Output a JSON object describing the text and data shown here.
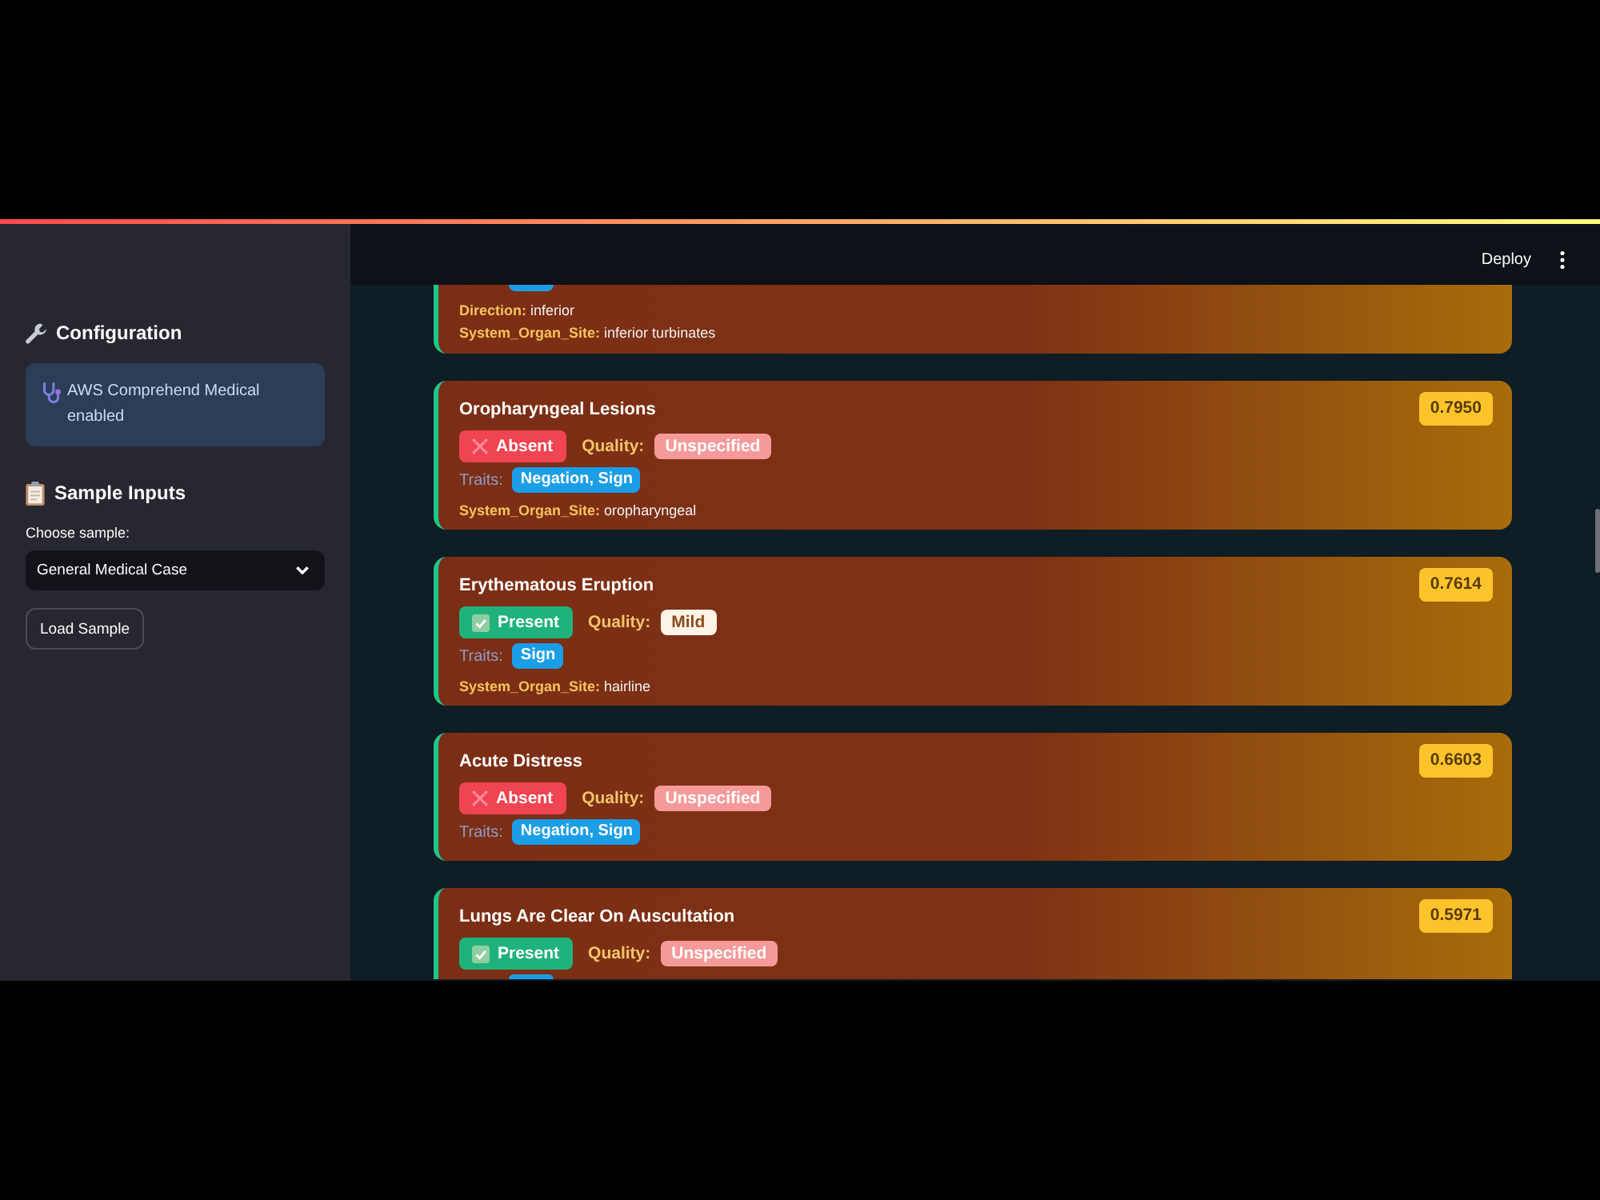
{
  "header": {
    "deploy": "Deploy"
  },
  "sidebar": {
    "configuration": {
      "title": "Configuration",
      "message": "AWS Comprehend Medical enabled"
    },
    "sample_inputs": {
      "title": "Sample Inputs",
      "select": {
        "label": "Choose sample:",
        "value": "General Medical Case"
      },
      "button": "Load Sample"
    }
  },
  "entities": [
    {
      "kind": "top_cut",
      "details": [
        "**Direction:** inferior",
        "**System_Organ_Site:** inferior turbinates"
      ]
    },
    {
      "kind": "whole",
      "name": "Oropharyngeal Lesions",
      "score": "0.7950",
      "status": {
        "label": "Absent",
        "present": false
      },
      "quality_label": "Quality:",
      "quality": {
        "label": "Unspecified",
        "kind": "unspecified"
      },
      "traits_label": "Traits:",
      "traits": [
        "Negation, Sign"
      ],
      "details": [
        "**System_Organ_Site:** oropharyngeal"
      ]
    },
    {
      "kind": "whole",
      "name": "Erythematous Eruption",
      "score": "0.7614",
      "status": {
        "label": "Present",
        "present": true
      },
      "quality_label": "Quality:",
      "quality": {
        "label": "Mild",
        "kind": "mild"
      },
      "traits_label": "Traits:",
      "traits": [
        "Sign"
      ],
      "details": [
        "**System_Organ_Site:** hairline"
      ]
    },
    {
      "kind": "whole",
      "name": "Acute Distress",
      "score": "0.6603",
      "status": {
        "label": "Absent",
        "present": false
      },
      "quality_label": "Quality:",
      "quality": {
        "label": "Unspecified",
        "kind": "unspecified"
      },
      "traits_label": "Traits:",
      "traits": [
        "Negation, Sign"
      ]
    },
    {
      "kind": "bottom_cut",
      "name": "Lungs Are Clear On Auscultation",
      "score": "0.5971",
      "status": {
        "label": "Present",
        "present": true
      },
      "quality_label": "Quality:",
      "quality": {
        "label": "Unspecified",
        "kind": "unspecified"
      }
    }
  ]
}
